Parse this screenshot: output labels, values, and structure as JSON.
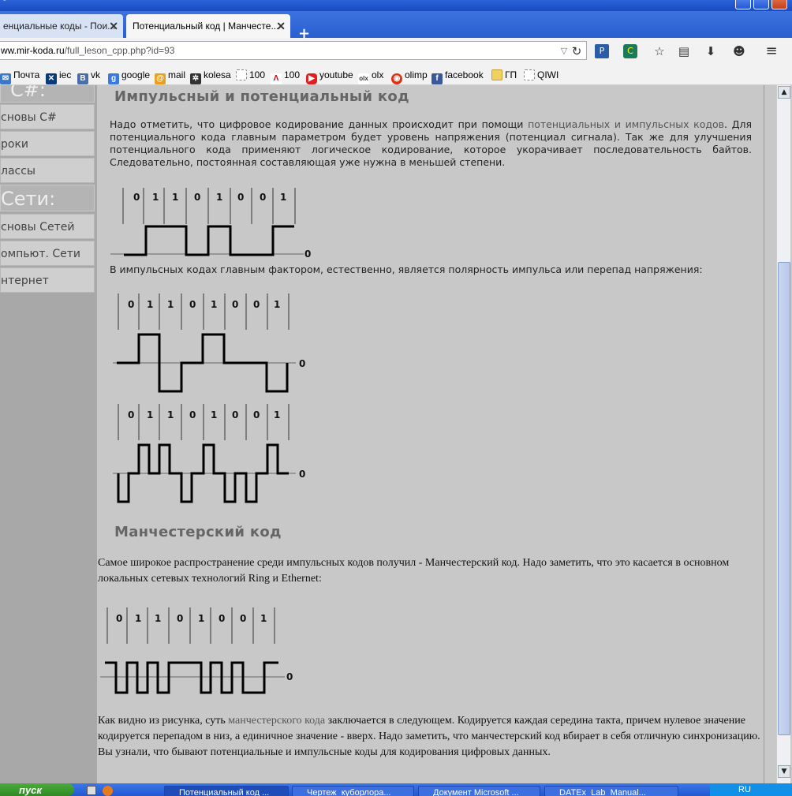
{
  "window": {
    "title": "-"
  },
  "tabs": [
    {
      "label": "енциальные коды - Пои...",
      "active": false
    },
    {
      "label": "Потенциальный код | Манчесте...",
      "active": true
    }
  ],
  "nav": {
    "url_host": "ww.mir-koda.ru",
    "url_path": "/full_leson_cpp.php?id=93"
  },
  "bookmarks": [
    {
      "label": "Почта",
      "icon": "mail-icon"
    },
    {
      "label": "iec",
      "icon": "iec-icon"
    },
    {
      "label": "vk",
      "icon": "vk-icon"
    },
    {
      "label": "google",
      "icon": "google-icon"
    },
    {
      "label": "mail",
      "icon": "at-icon"
    },
    {
      "label": "kolesa",
      "icon": "wheel-icon"
    },
    {
      "label": "100",
      "icon": "page-icon"
    },
    {
      "label": "100",
      "icon": "a-icon"
    },
    {
      "label": "youtube",
      "icon": "youtube-icon"
    },
    {
      "label": "olx",
      "icon": "olx-icon"
    },
    {
      "label": "olimp",
      "icon": "olimp-icon"
    },
    {
      "label": "facebook",
      "icon": "facebook-icon"
    },
    {
      "label": "ГП",
      "icon": "folder-icon"
    },
    {
      "label": "QIWI",
      "icon": "page-icon"
    }
  ],
  "sidebar": {
    "head1": "С#:",
    "items1": [
      "сновы С#",
      "роки",
      "лассы"
    ],
    "head2": "Сети:",
    "items2": [
      "сновы Сетей",
      "омпьют. Сети",
      "нтернет"
    ]
  },
  "article": {
    "heading1": "Импульсный и потенциальный код",
    "p1_a": "Надо отметить, что цифровое кодирование данных происходит при помощи ",
    "p1_link": "потенциальных и импульсных кодов",
    "p1_b": ". Для потенциального кода главным параметром будет уровень напряжения (потенциал сигнала). Так же для улучшения потенциального кода применяют логическое кодирование, которое укорачивает последовательность байтов. Следовательно, постоянная составляющая уже нужна в меньшей степени.",
    "p2": "В импульсных кодах главным фактором, естественно, является полярность импульса или перепад напряжения:",
    "heading2": "Манчестерский код",
    "p3": "Самое широкое распространение среди импульсных кодов получил - Манчестерский код. Надо заметить, что это касается в основном локальных сетевых технологий Ring и Ethernet:",
    "p4_a": "Как видно из рисунка, суть ",
    "p4_link": "манчестерского кода",
    "p4_b": " заключается в следующем. Кодируется каждая середина такта, причем нулевое значение кодируется перепадом в низ, а единичное значение - вверх. Надо заметить, что манчестерский код вбирает в себя отличную синхронизацию. Вы узнали, что бывают потенциальные и импульсные коды для кодирования цифровых данных."
  },
  "diagram": {
    "bits": [
      "0",
      "1",
      "1",
      "0",
      "1",
      "0",
      "0",
      "1"
    ],
    "zero_label": "0"
  },
  "taskbar": {
    "start": "пуск",
    "tasks": [
      "Потенциальный код ...",
      "Чертеж_куборлора...",
      "Документ Microsoft ...",
      "DATEx_Lab_Manual..."
    ],
    "tray": "RU"
  }
}
